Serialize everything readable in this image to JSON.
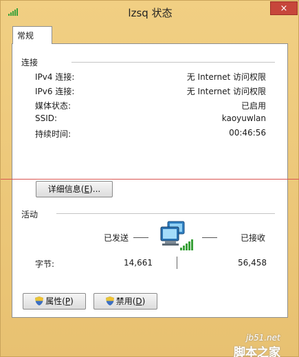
{
  "window": {
    "title": "lzsq 状态",
    "close_label": "×"
  },
  "tabs": [
    {
      "label": "常规",
      "selected": true
    }
  ],
  "connection": {
    "title": "连接",
    "rows": [
      {
        "label": "IPv4 连接:",
        "value": "无 Internet 访问权限"
      },
      {
        "label": "IPv6 连接:",
        "value": "无 Internet 访问权限"
      },
      {
        "label": "媒体状态:",
        "value": "已启用"
      },
      {
        "label": "SSID:",
        "value": "kaoyuwlan"
      },
      {
        "label": "持续时间:",
        "value": "00:46:56"
      }
    ],
    "details_button": {
      "prefix": "详细信息(",
      "accel": "E",
      "suffix": ")..."
    }
  },
  "activity": {
    "title": "活动",
    "sent_label": "已发送",
    "received_label": "已接收",
    "bytes_label": "字节:",
    "bytes_sent": "14,661",
    "bytes_received": "56,458"
  },
  "buttons": {
    "properties": {
      "prefix": "属性(",
      "accel": "P",
      "suffix": ")"
    },
    "disable": {
      "prefix": "禁用(",
      "accel": "D",
      "suffix": ")"
    }
  },
  "watermark": {
    "site": "jb51.net",
    "brand": "脚本之家"
  },
  "colors": {
    "window_frame": "#e9c77a",
    "close_button": "#c7463b",
    "panel": "#ffffff",
    "signal_green": "#3aa13a"
  },
  "icons": [
    "wifi-signal-icon",
    "network-computers-icon",
    "uac-shield-icon"
  ]
}
